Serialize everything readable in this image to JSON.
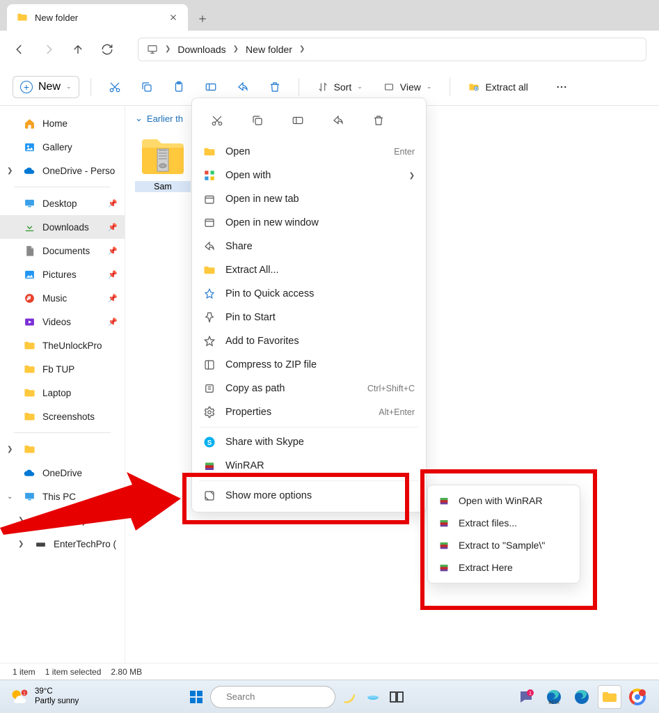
{
  "tab": {
    "title": "New folder"
  },
  "breadcrumb": {
    "root": "Downloads",
    "current": "New folder"
  },
  "toolbar": {
    "new": "New",
    "sort": "Sort",
    "view": "View",
    "extract_all": "Extract all"
  },
  "sidebar": {
    "home": "Home",
    "gallery": "Gallery",
    "onedrive_personal": "OneDrive - Perso",
    "desktop": "Desktop",
    "downloads": "Downloads",
    "documents": "Documents",
    "pictures": "Pictures",
    "music": "Music",
    "videos": "Videos",
    "unlock": "TheUnlockPro",
    "fbtup": "Fb TUP",
    "laptop": "Laptop",
    "screenshots": "Screenshots",
    "onedrive": "OneDrive",
    "thispc": "This PC",
    "osc": "OS (C:)",
    "etp": "EnterTechPro ("
  },
  "content": {
    "group": "Earlier th",
    "file": "Sam"
  },
  "context_menu": {
    "open": "Open",
    "open_shortcut": "Enter",
    "open_with": "Open with",
    "open_new_tab": "Open in new tab",
    "open_new_window": "Open in new window",
    "share": "Share",
    "extract_all": "Extract All...",
    "pin_quick": "Pin to Quick access",
    "pin_start": "Pin to Start",
    "add_favorites": "Add to Favorites",
    "compress_zip": "Compress to ZIP file",
    "copy_path": "Copy as path",
    "copy_path_shortcut": "Ctrl+Shift+C",
    "properties": "Properties",
    "properties_shortcut": "Alt+Enter",
    "share_skype": "Share with Skype",
    "winrar": "WinRAR",
    "show_more": "Show more options"
  },
  "winrar_submenu": {
    "open": "Open with WinRAR",
    "extract_files": "Extract files...",
    "extract_to": "Extract to \"Sample\\\"",
    "extract_here": "Extract Here"
  },
  "status": {
    "count": "1 item",
    "selected": "1 item selected",
    "size": "2.80 MB"
  },
  "taskbar": {
    "temp": "39°C",
    "weather": "Partly sunny",
    "search_placeholder": "Search"
  }
}
